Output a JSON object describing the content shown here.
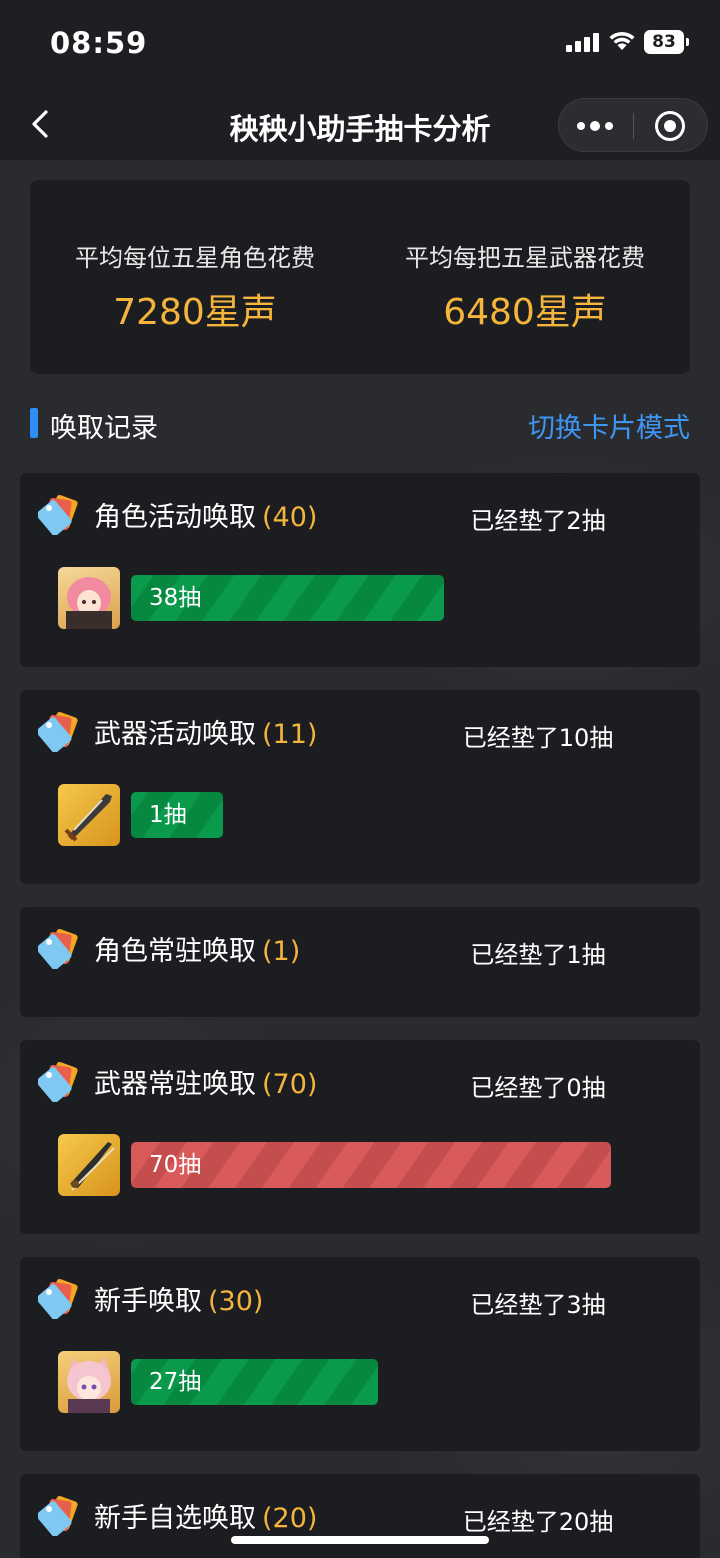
{
  "status": {
    "time": "08:59",
    "battery": "83"
  },
  "nav": {
    "title": "秧秧小助手抽卡分析"
  },
  "summary": {
    "character_label": "平均每位五星角色花费",
    "character_value": "7280星声",
    "weapon_label": "平均每把五星武器花费",
    "weapon_value": "6480星声"
  },
  "section": {
    "title": "唤取记录",
    "switch_label": "切换卡片模式"
  },
  "colors": {
    "accent_gold": "#f5b53c",
    "link_blue": "#3e95f2",
    "bar_green": "#0a9a4c",
    "bar_red": "#d95a5a"
  },
  "cards": [
    {
      "title": "角色活动唤取",
      "count": "(40)",
      "pity": "已经垫了2抽",
      "records": [
        {
          "label": "38抽",
          "pulls": 38,
          "status": "green",
          "icon": "character-avatar-pink-hair"
        }
      ]
    },
    {
      "title": "武器活动唤取",
      "count": "(11)",
      "pity": "已经垫了10抽",
      "records": [
        {
          "label": "1抽",
          "pulls": 1,
          "status": "green",
          "icon": "weapon-sword"
        }
      ]
    },
    {
      "title": "角色常驻唤取",
      "count": "(1)",
      "pity": "已经垫了1抽",
      "records": []
    },
    {
      "title": "武器常驻唤取",
      "count": "(70)",
      "pity": "已经垫了0抽",
      "records": [
        {
          "label": "70抽",
          "pulls": 70,
          "status": "red",
          "icon": "weapon-blade"
        }
      ]
    },
    {
      "title": "新手唤取",
      "count": "(30)",
      "pity": "已经垫了3抽",
      "records": [
        {
          "label": "27抽",
          "pulls": 27,
          "status": "green",
          "icon": "character-avatar-cat-ears"
        }
      ]
    },
    {
      "title": "新手自选唤取",
      "count": "(20)",
      "pity": "已经垫了20抽",
      "records": []
    }
  ]
}
